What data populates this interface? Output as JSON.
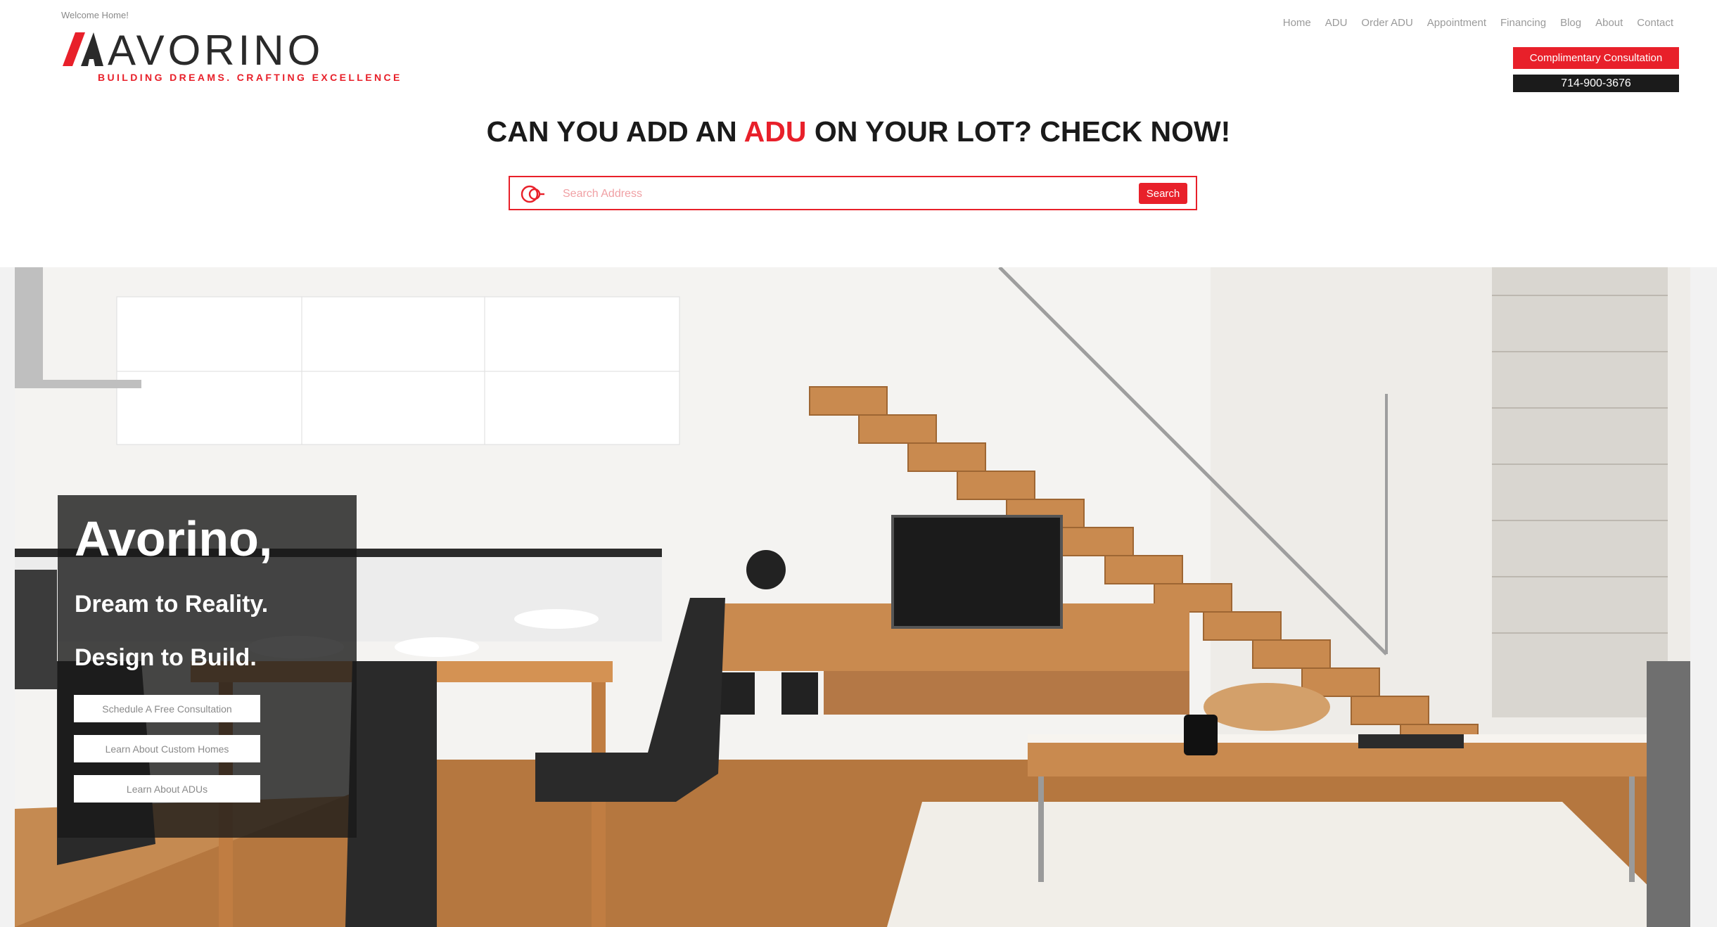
{
  "header": {
    "welcome": "Welcome Home!",
    "logo_word": "AVORINO",
    "logo_tagline": "BUILDING DREAMS. CRAFTING EXCELLENCE",
    "nav": [
      "Home",
      "ADU",
      "Order ADU",
      "Appointment",
      "Financing",
      "Blog",
      "About",
      "Contact"
    ],
    "consult_button": "Complimentary Consultation",
    "phone": "714-900-3676"
  },
  "check": {
    "headline_pre": "CAN YOU ADD AN ",
    "headline_accent": "ADU",
    "headline_post": " ON YOUR LOT? CHECK NOW!",
    "search_placeholder": "Search Address",
    "search_button": "Search"
  },
  "hero": {
    "title": "Avorino,",
    "line1": "Dream to Reality.",
    "line2": "Design to Build.",
    "buttons": [
      "Schedule A Free Consultation",
      "Learn About Custom Homes",
      "Learn About ADUs"
    ]
  },
  "colors": {
    "accent": "#e8202a",
    "dark": "#1b1b1b",
    "wood": "#c98a4f"
  }
}
